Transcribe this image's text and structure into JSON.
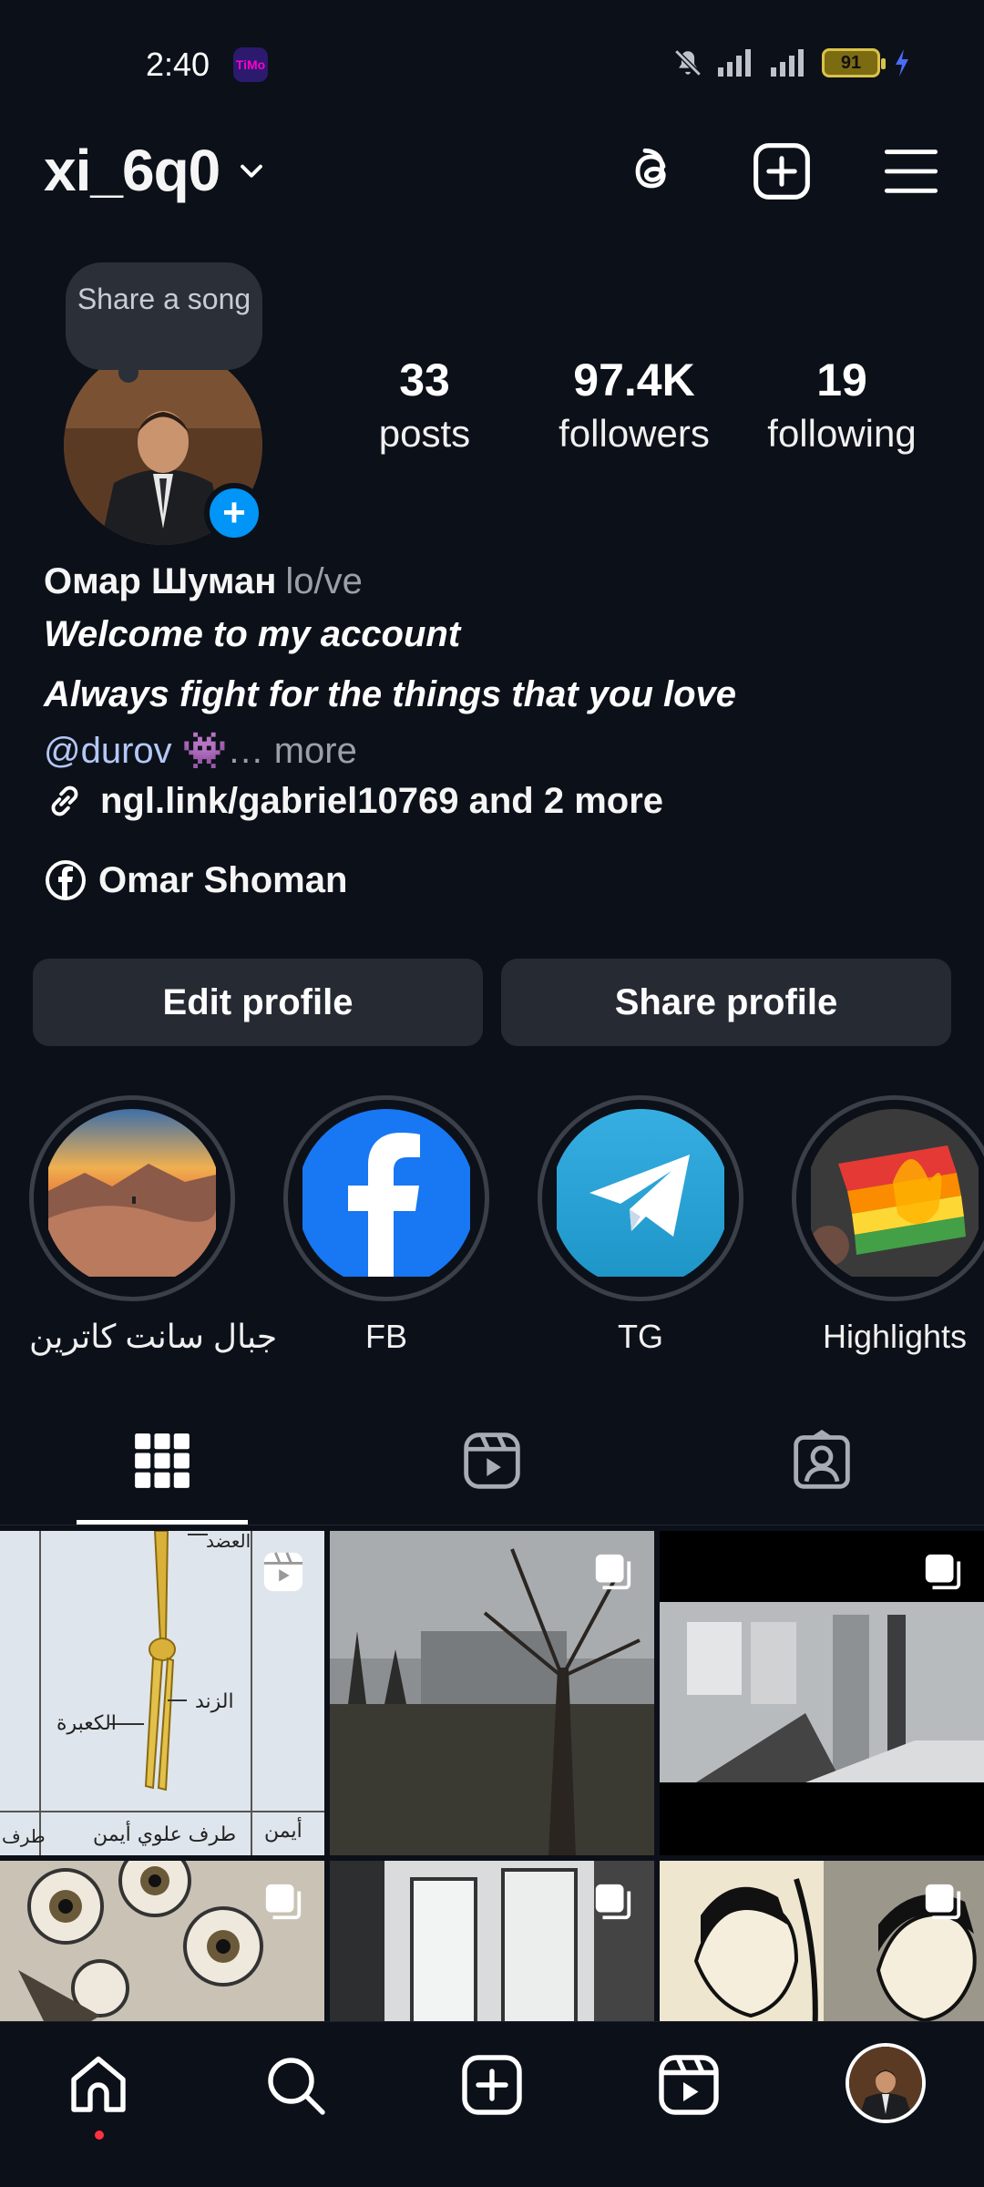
{
  "status_bar": {
    "time": "2:40",
    "app_badge": "TiMo",
    "battery": "91",
    "icons": [
      "mute-icon",
      "signal-icon",
      "signal-icon",
      "battery-icon",
      "charging-icon"
    ]
  },
  "header": {
    "username": "xi_6q0",
    "icons": [
      "chevron-down-icon",
      "threads-icon",
      "add-post-icon",
      "menu-icon"
    ]
  },
  "profile": {
    "note": "Share a song",
    "stats": [
      {
        "value": "33",
        "label": "posts"
      },
      {
        "value": "97.4K",
        "label": "followers"
      },
      {
        "value": "19",
        "label": "following"
      }
    ],
    "name": "Омар Шуман",
    "pronouns": "lo/ve",
    "bio_line_1": "Welcome to my account",
    "bio_line_2": "Always fight for the things that you love",
    "mention": "@durov",
    "mention_emoji": "👾",
    "more": "… more",
    "link": "ngl.link/gabriel10769 and 2 more",
    "facebook_name": "Omar Shoman"
  },
  "buttons": {
    "edit_profile": "Edit profile",
    "share_profile": "Share profile"
  },
  "highlights": [
    {
      "label": "جبال سانت كاترين"
    },
    {
      "label": "FB"
    },
    {
      "label": "TG"
    },
    {
      "label": "Highlights"
    }
  ],
  "tabs": [
    "grid-icon",
    "reels-icon",
    "tagged-icon"
  ],
  "grid_labels": {
    "cell1_a": "العضد",
    "cell1_b": "الزند",
    "cell1_c": "الكعبرة",
    "cell1_d": "طرف علوي أيمن",
    "cell1_e": "أيمن",
    "cell1_f": "طرف"
  },
  "colors": {
    "background": "#0c1018",
    "button": "#262a33",
    "accent_blue": "#0095f6",
    "mention": "#b2c8f7",
    "notification_dot": "#ff3040"
  },
  "bottom_nav": [
    "home-icon",
    "search-icon",
    "create-icon",
    "reels-icon",
    "profile-avatar"
  ]
}
